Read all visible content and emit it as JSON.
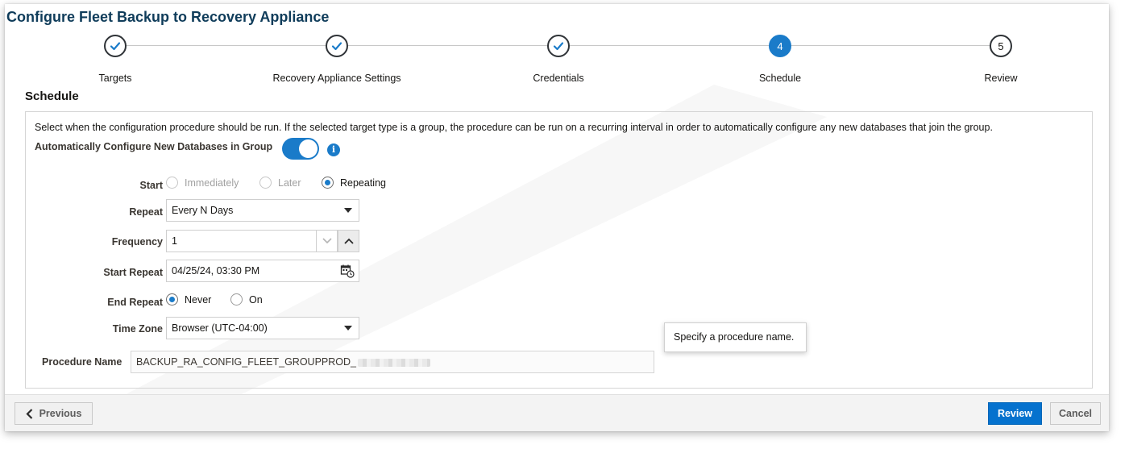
{
  "window": {
    "title": "Configure Fleet Backup to Recovery Appliance"
  },
  "train": {
    "steps": [
      {
        "label": "Targets",
        "status": "complete",
        "icon": "check-icon"
      },
      {
        "label": "Recovery Appliance Settings",
        "status": "complete",
        "icon": "check-icon"
      },
      {
        "label": "Credentials",
        "status": "complete",
        "icon": "check-icon"
      },
      {
        "label": "Schedule",
        "status": "current",
        "number": "4"
      },
      {
        "label": "Review",
        "status": "pending",
        "number": "5"
      }
    ]
  },
  "schedule": {
    "section_title": "Schedule",
    "description": "Select when the configuration procedure should be run. If the selected target type is a group, the procedure can be run on a recurring interval in order to automatically configure any new databases that join the group.",
    "auto_configure": {
      "label": "Automatically Configure New Databases in Group",
      "enabled": true,
      "info_icon": "info-icon"
    },
    "start": {
      "label": "Start",
      "options": [
        {
          "label": "Immediately",
          "selected": false,
          "disabled": true
        },
        {
          "label": "Later",
          "selected": false,
          "disabled": true
        },
        {
          "label": "Repeating",
          "selected": true,
          "disabled": false
        }
      ]
    },
    "repeat": {
      "label": "Repeat",
      "value": "Every N Days"
    },
    "frequency": {
      "label": "Frequency",
      "value": "1"
    },
    "start_repeat": {
      "label": "Start Repeat",
      "value": "04/25/24, 03:30 PM",
      "icon": "calendar-clock-icon"
    },
    "end_repeat": {
      "label": "End Repeat",
      "options": [
        {
          "label": "Never",
          "selected": true
        },
        {
          "label": "On",
          "selected": false
        }
      ]
    },
    "time_zone": {
      "label": "Time Zone",
      "value": "Browser (UTC-04:00)"
    },
    "procedure_name": {
      "label": "Procedure Name",
      "value": "BACKUP_RA_CONFIG_FLEET_GROUPPROD_",
      "tooltip": "Specify a procedure name."
    }
  },
  "footer": {
    "previous_label": "Previous",
    "review_label": "Review",
    "cancel_label": "Cancel"
  },
  "colors": {
    "accent": "#1a7bc9",
    "title": "#0f3c5a",
    "primary_button": "#0572ce"
  }
}
